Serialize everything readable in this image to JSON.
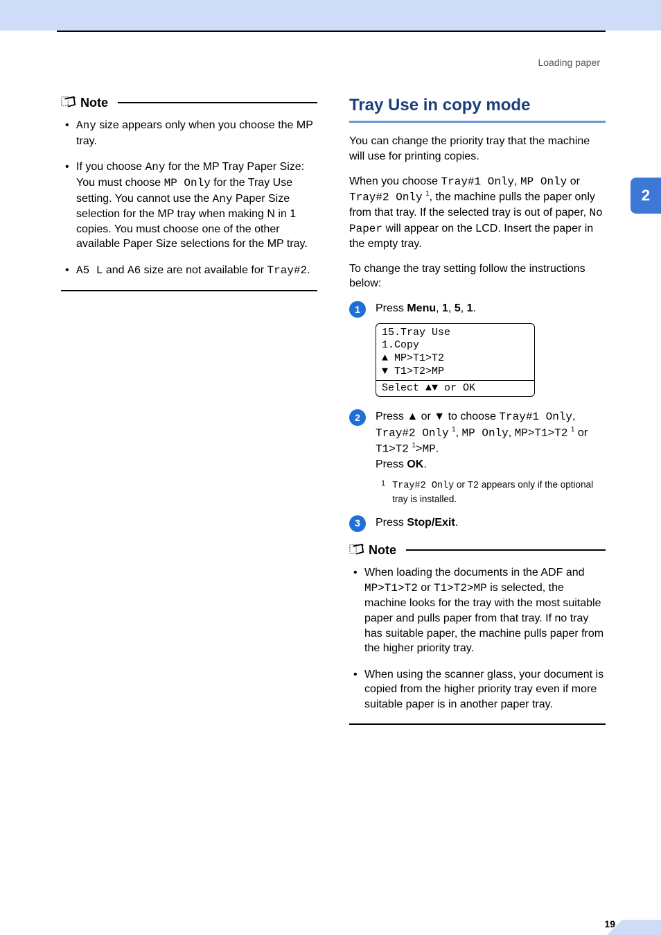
{
  "header": {
    "breadcrumb": "Loading paper"
  },
  "side": {
    "chapter": "2"
  },
  "footer": {
    "page": "19"
  },
  "left": {
    "note_label": "Note",
    "bullets": {
      "b1": {
        "pre": "",
        "code1": "Any",
        "post": " size appears only when you choose the MP tray."
      },
      "b2": {
        "t1": "If you choose ",
        "c1": "Any",
        "t2": " for the MP Tray Paper Size: You must choose ",
        "c2": "MP Only",
        "t3": " for the Tray Use setting. You cannot use the ",
        "c3": "Any",
        "t4": " Paper Size selection for the MP tray when making N in 1 copies. You must choose one of the other available Paper Size selections for the MP tray."
      },
      "b3": {
        "c1": "A5 L",
        "t1": " and ",
        "c2": "A6",
        "t2": " size are not available for ",
        "c3": "Tray#2",
        "t3": "."
      }
    }
  },
  "right": {
    "title": "Tray Use in copy mode",
    "intro": "You can change the priority tray that the machine will use for printing copies.",
    "p2": {
      "t1": "When you choose ",
      "c1": "Tray#1 Only",
      "t2": ", ",
      "c2": "MP Only",
      "t3": " or ",
      "c3": "Tray#2 Only",
      "sup1": "1",
      "t4": ", the machine pulls the paper only from that tray. If the selected tray is out of paper, ",
      "c4": "No Paper",
      "t5": " will appear on the LCD. Insert the paper in the empty tray."
    },
    "p3": "To change the tray setting follow the instructions below:",
    "step1": {
      "num": "1",
      "text": {
        "t1": "Press ",
        "b1": "Menu",
        "t2": ", ",
        "b2": "1",
        "t3": ", ",
        "b3": "5",
        "t4": ", ",
        "b4": "1",
        "t5": "."
      },
      "lcd": {
        "l1": "15.Tray Use",
        "l2": "  1.Copy",
        "l3": "▲   MP>T1>T2",
        "l4": "▼   T1>T2>MP",
        "l5": "Select ▲▼ or OK"
      }
    },
    "step2": {
      "num": "2",
      "text": {
        "t1": "Press ▲ or ▼ to choose ",
        "c1": "Tray#1 Only",
        "t2": ", ",
        "c2": "Tray#2 Only",
        "sup1": "1",
        "t3": ", ",
        "c3": "MP Only",
        "t4": ", ",
        "c4": "MP>T1>T2",
        "sup2": "1",
        "t5": " or ",
        "c5": "T1>T2",
        "sup3": "1",
        "t6": ">",
        "c6": "MP",
        "t7": ".",
        "br": "Press ",
        "b1": "OK",
        "t8": "."
      },
      "fn": {
        "mark": "1",
        "c1": "Tray#2 Only",
        "t1": " or ",
        "c2": "T2",
        "t2": " appears only if the optional tray is installed."
      }
    },
    "step3": {
      "num": "3",
      "text": {
        "t1": "Press ",
        "b1": "Stop/Exit",
        "t2": "."
      }
    },
    "note": {
      "label": "Note",
      "b1": {
        "t1": "When loading the documents in the ADF and ",
        "c1": "MP>T1>T2",
        "t2": " or ",
        "c2": "T1>T2>MP",
        "t3": " is selected, the machine looks for the tray with the most suitable paper and pulls paper from that tray. If no tray has suitable paper, the machine pulls paper from the higher priority tray."
      },
      "b2": "When using the scanner glass, your document is copied from the higher priority tray even if more suitable paper is in another paper tray."
    }
  }
}
